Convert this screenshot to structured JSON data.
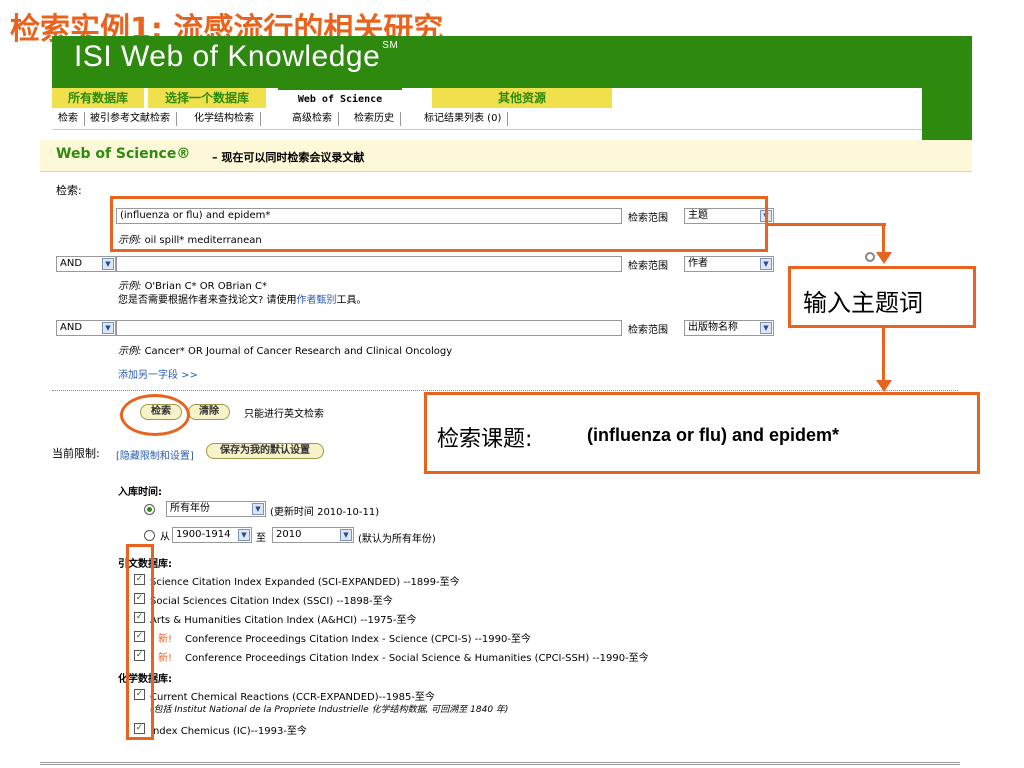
{
  "slide": {
    "title": "检索实例1: 流感流行的相关研究"
  },
  "header": {
    "logo": "ISI Web of Knowledge",
    "logo_sup": "SM"
  },
  "tabs": {
    "all_db": "所有数据库",
    "select_db": "选择一个数据库",
    "wos": "Web of Science",
    "other": "其他资源"
  },
  "subtabs": [
    "检索",
    "被引参考文献检索",
    "化学结构检索",
    "高级检索",
    "检索历史",
    "标记结果列表 (0)"
  ],
  "wos_band": {
    "title": "Web of Science®",
    "subtitle": "– 现在可以同时检索会议录文献"
  },
  "search": {
    "label": "检索:",
    "row1": {
      "value": "(influenza or flu) and epidem*",
      "example": "oil spill* mediterranean",
      "scope_label": "检索范围",
      "scope": "主题"
    },
    "row2": {
      "bool": "AND",
      "value": "",
      "example": "O'Brian C* OR OBrian C*",
      "hint_pre": "您是否需要根据作者来查找论文? 请使用",
      "hint_link": "作者甄别",
      "hint_post": "工具。",
      "scope_label": "检索范围",
      "scope": "作者"
    },
    "row3": {
      "bool": "AND",
      "value": "",
      "example": "Cancer* OR Journal of Cancer Research and Clinical Oncology",
      "scope_label": "检索范围",
      "scope": "出版物名称"
    },
    "example_prefix": "示例:",
    "add_field": "添加另一字段 >>",
    "search_button": "检索",
    "clear_button": "清除",
    "english_only": "只能进行英文检索"
  },
  "limits": {
    "label": "当前限制:",
    "hide_link": "[隐藏限制和设置]",
    "save_button": "保存为我的默认设置",
    "time_label": "入库时间:",
    "all_years": "所有年份",
    "updated": "(更新时间 2010-10-11)",
    "from": "从",
    "from_value": "1900-1914",
    "to": "至",
    "to_value": "2010",
    "default_note": "(默认为所有年份)"
  },
  "citation_db": {
    "label": "引文数据库:",
    "items": [
      "Science Citation Index Expanded (SCI-EXPANDED) --1899-至今",
      "Social Sciences Citation Index (SSCI) --1898-至今",
      "Arts & Humanities Citation Index (A&HCI) --1975-至今",
      "Conference Proceedings Citation Index - Science (CPCI-S) --1990-至今",
      "Conference Proceedings Citation Index - Social Science & Humanities (CPCI-SSH) --1990-至今"
    ],
    "new_badge": "新!"
  },
  "chem_db": {
    "label": "化学数据库:",
    "item1": "Current Chemical Reactions (CCR-EXPANDED)--1985-至今",
    "item1_note": "(包括 Institut National de la Propriete Industrielle 化学结构数据, 可回溯至 1840 年)",
    "item2": "Index Chemicus (IC)--1993-至今"
  },
  "callouts": {
    "topic_word": "输入主题词",
    "subject_label": "检索课题:",
    "subject_value": "(influenza or flu) and epidem*"
  },
  "colors": {
    "accent": "#e8641e",
    "brand_green": "#2d8a0e",
    "tab_yellow": "#f0e04c"
  }
}
